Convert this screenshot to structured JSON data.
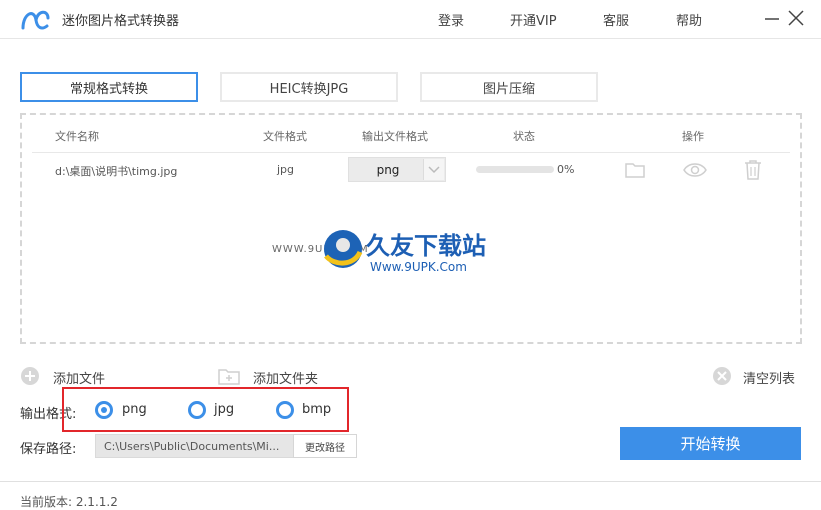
{
  "titlebar": {
    "title": "迷你图片格式转换器",
    "login": "登录",
    "vip": "开通VIP",
    "service": "客服",
    "help": "帮助"
  },
  "tabs": [
    {
      "label": "常规格式转换",
      "active": true
    },
    {
      "label": "HEIC转换JPG",
      "active": false
    },
    {
      "label": "图片压缩",
      "active": false
    }
  ],
  "table": {
    "columns": [
      "文件名称",
      "文件格式",
      "输出文件格式",
      "状态",
      "操作"
    ],
    "rows": [
      {
        "name": "d:\\桌面\\说明书\\timg.jpg",
        "format": "jpg",
        "output": "png",
        "progress_percent": 0,
        "status": "0%"
      }
    ]
  },
  "watermark": {
    "small": "WWW.9UPK.COM",
    "brand": "久友下载站",
    "url": "Www.9UPK.Com"
  },
  "actions": {
    "add_file": "添加文件",
    "add_folder": "添加文件夹",
    "clear_list": "清空列表"
  },
  "output": {
    "label": "输出格式:",
    "options": [
      "png",
      "jpg",
      "bmp"
    ],
    "selected": "png"
  },
  "save": {
    "label": "保存路径:",
    "path": "C:\\Users\\Public\\Documents\\Mi...",
    "change_button": "更改路径"
  },
  "start_button": "开始转换",
  "footer": {
    "version": "当前版本: 2.1.1.2"
  },
  "colors": {
    "accent": "#3c8fe8",
    "highlight": "#e2262b"
  }
}
